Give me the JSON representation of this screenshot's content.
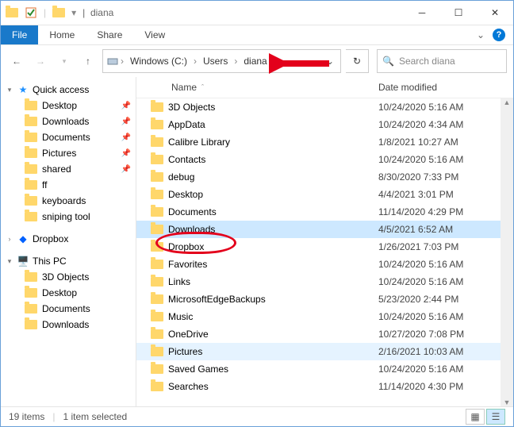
{
  "titlebar": {
    "title_sep": "|",
    "title": "diana"
  },
  "ribbon": {
    "file": "File",
    "home": "Home",
    "share": "Share",
    "view": "View"
  },
  "breadcrumbs": {
    "drive": "Windows (C:)",
    "users": "Users",
    "current": "diana"
  },
  "search": {
    "placeholder": "Search diana"
  },
  "columns": {
    "name": "Name",
    "date": "Date modified"
  },
  "sidebar": {
    "quick": "Quick access",
    "items": [
      {
        "label": "Desktop",
        "pin": true
      },
      {
        "label": "Downloads",
        "pin": true
      },
      {
        "label": "Documents",
        "pin": true
      },
      {
        "label": "Pictures",
        "pin": true
      },
      {
        "label": "shared",
        "pin": true
      },
      {
        "label": "ff",
        "pin": false
      },
      {
        "label": "keyboards",
        "pin": false
      },
      {
        "label": "sniping tool",
        "pin": false
      }
    ],
    "dropbox": "Dropbox",
    "thispc": "This PC",
    "pc": [
      {
        "label": "3D Objects"
      },
      {
        "label": "Desktop"
      },
      {
        "label": "Documents"
      },
      {
        "label": "Downloads"
      }
    ]
  },
  "files": [
    {
      "name": "3D Objects",
      "date": "10/24/2020 5:16 AM"
    },
    {
      "name": "AppData",
      "date": "10/24/2020 4:34 AM"
    },
    {
      "name": "Calibre Library",
      "date": "1/8/2021 10:27 AM"
    },
    {
      "name": "Contacts",
      "date": "10/24/2020 5:16 AM"
    },
    {
      "name": "debug",
      "date": "8/30/2020 7:33 PM"
    },
    {
      "name": "Desktop",
      "date": "4/4/2021 3:01 PM"
    },
    {
      "name": "Documents",
      "date": "11/14/2020 4:29 PM"
    },
    {
      "name": "Downloads",
      "date": "4/5/2021 6:52 AM",
      "selected": true
    },
    {
      "name": "Dropbox",
      "date": "1/26/2021 7:03 PM"
    },
    {
      "name": "Favorites",
      "date": "10/24/2020 5:16 AM"
    },
    {
      "name": "Links",
      "date": "10/24/2020 5:16 AM"
    },
    {
      "name": "MicrosoftEdgeBackups",
      "date": "5/23/2020 2:44 PM"
    },
    {
      "name": "Music",
      "date": "10/24/2020 5:16 AM"
    },
    {
      "name": "OneDrive",
      "date": "10/27/2020 7:08 PM"
    },
    {
      "name": "Pictures",
      "date": "2/16/2021 10:03 AM",
      "lite": true
    },
    {
      "name": "Saved Games",
      "date": "10/24/2020 5:16 AM"
    },
    {
      "name": "Searches",
      "date": "11/14/2020 4:30 PM"
    }
  ],
  "status": {
    "count": "19 items",
    "selected": "1 item selected"
  }
}
